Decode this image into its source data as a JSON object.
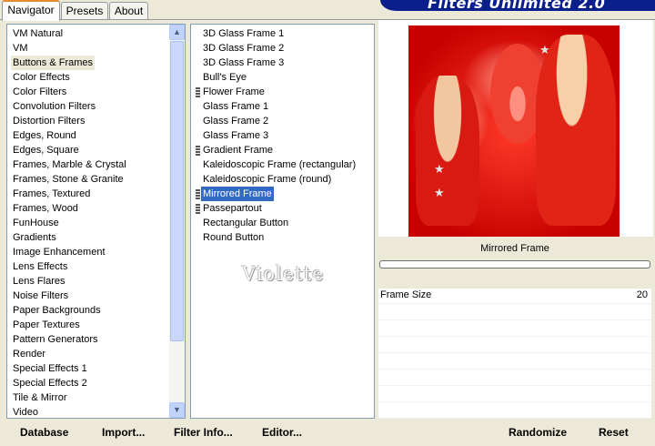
{
  "tabs": [
    {
      "label": "Navigator",
      "active": true
    },
    {
      "label": "Presets",
      "active": false
    },
    {
      "label": "About",
      "active": false
    }
  ],
  "banner_title": "Filters Unlimited 2.0",
  "categories": [
    "VM Natural",
    "VM",
    "Buttons & Frames",
    "Color Effects",
    "Color Filters",
    "Convolution Filters",
    "Distortion Filters",
    "Edges, Round",
    "Edges, Square",
    "Frames, Marble & Crystal",
    "Frames, Stone & Granite",
    "Frames, Textured",
    "Frames, Wood",
    "FunHouse",
    "Gradients",
    "Image Enhancement",
    "Lens Effects",
    "Lens Flares",
    "Noise Filters",
    "Paper Backgrounds",
    "Paper Textures",
    "Pattern Generators",
    "Render",
    "Special Effects 1",
    "Special Effects 2",
    "Tile & Mirror",
    "Video"
  ],
  "selected_category": "Buttons & Frames",
  "filters": [
    {
      "label": "3D Glass Frame 1",
      "grip": false
    },
    {
      "label": "3D Glass Frame 2",
      "grip": false
    },
    {
      "label": "3D Glass Frame 3",
      "grip": false
    },
    {
      "label": "Bull's Eye",
      "grip": false
    },
    {
      "label": "Flower Frame",
      "grip": true
    },
    {
      "label": "Glass Frame 1",
      "grip": false
    },
    {
      "label": "Glass Frame 2",
      "grip": false
    },
    {
      "label": "Glass Frame 3",
      "grip": false
    },
    {
      "label": "Gradient Frame",
      "grip": true
    },
    {
      "label": "Kaleidoscopic Frame (rectangular)",
      "grip": false
    },
    {
      "label": "Kaleidoscopic Frame (round)",
      "grip": false
    },
    {
      "label": "Mirrored Frame",
      "grip": true
    },
    {
      "label": "Passepartout",
      "grip": true
    },
    {
      "label": "Rectangular Button",
      "grip": false
    },
    {
      "label": "Round Button",
      "grip": false
    }
  ],
  "selected_filter": "Mirrored Frame",
  "watermark": "Violette",
  "preview_filter_name": "Mirrored Frame",
  "progress": 0,
  "params": [
    {
      "label": "Frame Size",
      "value": "20"
    }
  ],
  "buttons": {
    "database": "Database",
    "import": "Import...",
    "filter_info": "Filter Info...",
    "editor": "Editor...",
    "randomize": "Randomize",
    "reset": "Reset"
  },
  "icons": {
    "scroll_up": "chevron-up-icon",
    "scroll_down": "chevron-down-icon",
    "star": "star-icon"
  },
  "colors": {
    "selection": "#316ac5",
    "banner": "#0a1f8c",
    "tab_accent": "#e68b2c",
    "preview_red": "#d40000"
  }
}
